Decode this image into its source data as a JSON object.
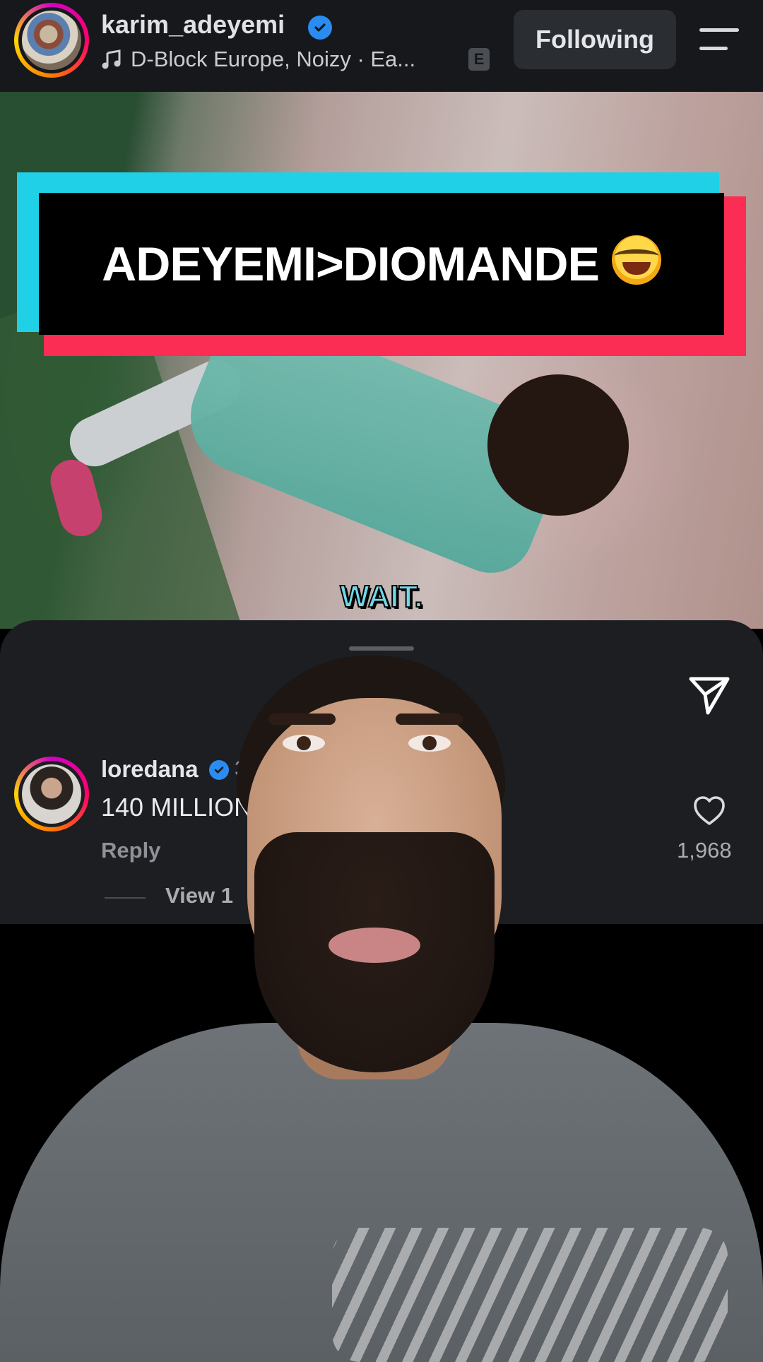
{
  "header": {
    "username": "karim_adeyemi",
    "music": "D-Block Europe, Noizy · Ea...",
    "explicit_badge": "E",
    "follow_label": "Following"
  },
  "video": {
    "caption_title": "ADEYEMI>DIOMANDE",
    "caption_emoji": "face-with-tears-of-joy-emoji",
    "subtitle": "WAIT."
  },
  "comment": {
    "username": "loredana",
    "time": "35",
    "text": "140 MILLION",
    "reply_label": "Reply",
    "likes": "1,968",
    "view_replies": "View 1"
  },
  "colors": {
    "cyan": "#1fd0e6",
    "red": "#fc2d55",
    "verified": "#2a8cf0"
  }
}
